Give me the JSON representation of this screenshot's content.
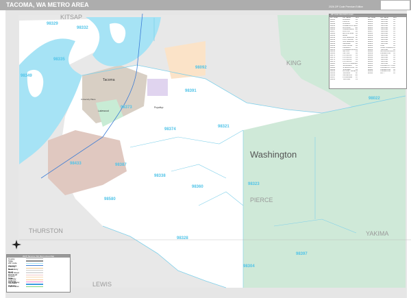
{
  "header": {
    "title": "TACOMA, WA METRO AREA",
    "edition": "2026 ZIP Code Premium Edition"
  },
  "map": {
    "regions": [
      "KITSAP",
      "KING",
      "Washington",
      "PIERCE",
      "THURSTON",
      "LEWIS",
      "YAKIMA"
    ],
    "cities": [
      "Tacoma",
      "Lakewood",
      "University Place",
      "Puyallup"
    ],
    "zips": [
      {
        "code": "98329"
      },
      {
        "code": "98332"
      },
      {
        "code": "98335"
      },
      {
        "code": "98092"
      },
      {
        "code": "98391"
      },
      {
        "code": "98349"
      },
      {
        "code": "98433"
      },
      {
        "code": "98387"
      },
      {
        "code": "98338"
      },
      {
        "code": "98360"
      },
      {
        "code": "98580"
      },
      {
        "code": "98328"
      },
      {
        "code": "98323"
      },
      {
        "code": "98304"
      },
      {
        "code": "98397"
      },
      {
        "code": "98022"
      },
      {
        "code": "98321"
      },
      {
        "code": "98373"
      },
      {
        "code": "98374"
      }
    ],
    "colors": {
      "water": "#a6e3f5",
      "forest": "#cfe9d8",
      "outside": "#e8e8e8",
      "military": "#e0c8c0",
      "zip": "#4fc3e8"
    }
  },
  "zip_table": {
    "title": "ZIP Code Index/Grid Locator",
    "headers": [
      "ZIP Code",
      "ZIP Name",
      "Grid",
      "ZIP Code",
      "ZIP Name",
      "Grid"
    ],
    "rows": [
      [
        "98001",
        "AUBURN",
        "D3",
        "98401",
        "TACOMA",
        "C3"
      ],
      [
        "98047",
        "PACIFIC",
        "D3",
        "98402",
        "TACOMA",
        "C3"
      ],
      [
        "98092",
        "AUBURN",
        "D3",
        "98403",
        "TACOMA",
        "C3"
      ],
      [
        "98303",
        "ANDERSON ISLAND",
        "B4",
        "98404",
        "TACOMA",
        "C3"
      ],
      [
        "98321",
        "BUCKLEY",
        "E4",
        "98405",
        "TACOMA",
        "C3"
      ],
      [
        "98323",
        "CARBONADO",
        "E4",
        "98406",
        "TACOMA",
        "C3"
      ],
      [
        "98327",
        "DUPONT",
        "B4",
        "98407",
        "TACOMA",
        "C3"
      ],
      [
        "98328",
        "EATONVILLE",
        "D5",
        "98408",
        "TACOMA",
        "C3"
      ],
      [
        "98330",
        "ELBE",
        "D6",
        "98409",
        "TACOMA",
        "C3"
      ],
      [
        "98332",
        "GIG HARBOR",
        "B2",
        "98416",
        "TACOMA",
        "C3"
      ],
      [
        "98333",
        "FOX ISLAND",
        "B3",
        "98418",
        "TACOMA",
        "C3"
      ],
      [
        "98335",
        "GIG HARBOR",
        "B3",
        "98421",
        "TACOMA",
        "C3"
      ],
      [
        "98338",
        "GRAHAM",
        "D4",
        "98422",
        "TACOMA",
        "C3"
      ],
      [
        "98344",
        "KAPOWSIN",
        "D4",
        "98424",
        "FIFE",
        "C3"
      ],
      [
        "98349",
        "LAKEBAY",
        "A3",
        "98430",
        "CAMP MURRAY",
        "C4"
      ],
      [
        "98351",
        "LONGBRANCH",
        "A3",
        "98433",
        "TACOMA",
        "C4"
      ],
      [
        "98354",
        "MILTON",
        "C3",
        "98438",
        "MCCHORD AFB",
        "C4"
      ],
      [
        "98360",
        "ORTING",
        "D4",
        "98439",
        "LAKEWOOD",
        "C4"
      ],
      [
        "98371",
        "PUYALLUP",
        "C3",
        "98443",
        "TACOMA",
        "C3"
      ],
      [
        "98372",
        "PUYALLUP",
        "C3",
        "98444",
        "TACOMA",
        "C4"
      ],
      [
        "98373",
        "PUYALLUP",
        "C4",
        "98445",
        "TACOMA",
        "C4"
      ],
      [
        "98374",
        "PUYALLUP",
        "C4",
        "98446",
        "TACOMA",
        "C4"
      ],
      [
        "98385",
        "SOUTH PRAIRIE",
        "E4",
        "98465",
        "TACOMA",
        "C3"
      ],
      [
        "98387",
        "SPANAWAY",
        "C4",
        "98466",
        "UNIVERSITY PLACE",
        "B3"
      ],
      [
        "98388",
        "STEILACOOM",
        "B4",
        "98467",
        "UNIVERSITY PLACE",
        "B3"
      ],
      [
        "98390",
        "SUMNER",
        "D3",
        "98498",
        "LAKEWOOD",
        "C4"
      ],
      [
        "98391",
        "BONNEY LAKE",
        "D3",
        "98499",
        "LAKEWOOD",
        "C4"
      ],
      [
        "98394",
        "VAUGHN",
        "A2",
        "98580",
        "ROY",
        "C5"
      ],
      [
        "98396",
        "WILKESON",
        "E4",
        "",
        "",
        ""
      ],
      [
        "98397",
        "LONGMIRE",
        "F6",
        "",
        "",
        ""
      ],
      [
        "98402",
        "TACOMA",
        "C3",
        "",
        "",
        ""
      ]
    ]
  },
  "legend": {
    "title": "2026 Tacoma, WA Metro Area Map",
    "items": [
      "County",
      "State",
      "ZIP Code",
      "Interstate",
      "Primary Road",
      "Secondary Road",
      "Minor Road",
      "Rail Road",
      "County Highway",
      "State Highway",
      "US Highway",
      "Interstate Highway",
      "Park/Forest"
    ],
    "colors": [
      "#bbb",
      "#888",
      "#a6e3f5",
      "#3a7bd5",
      "#f0c890",
      "#ccc",
      "#ddd",
      "#f4c7c7",
      "#f7d8b0",
      "#f7c890",
      "#ff88cc",
      "#3a9be0",
      "#7cd67c"
    ]
  }
}
